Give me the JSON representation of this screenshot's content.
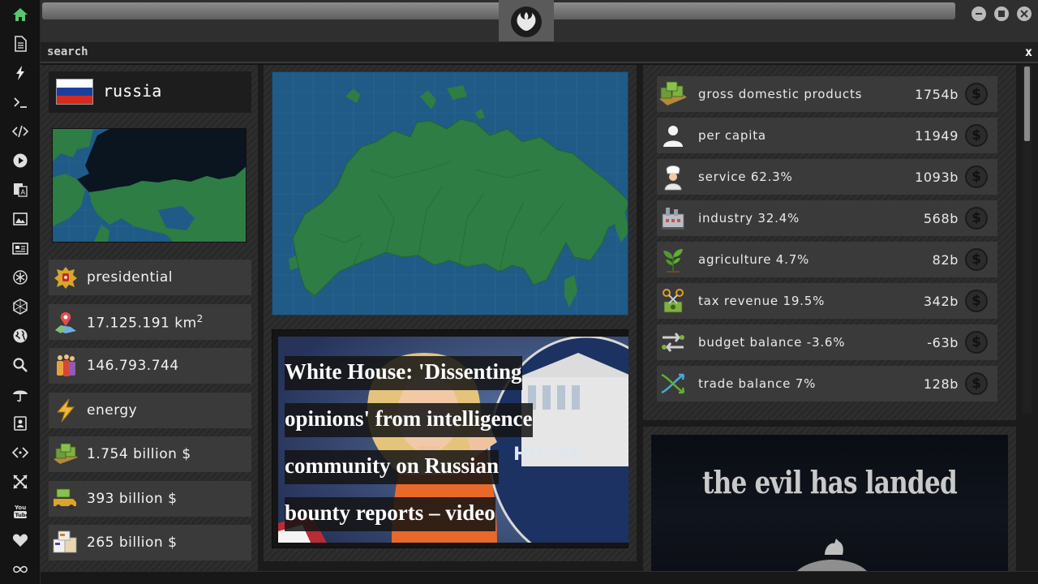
{
  "search": {
    "label": "search",
    "close": "x"
  },
  "country": {
    "name": "russia"
  },
  "stats": [
    {
      "icon": "coat-of-arms-icon",
      "text": "presidential"
    },
    {
      "icon": "map-pin-icon",
      "text": "17.125.191 km",
      "sup": "2"
    },
    {
      "icon": "population-icon",
      "text": "146.793.744"
    },
    {
      "icon": "lightning-icon",
      "text": "energy"
    },
    {
      "icon": "money-stack-icon",
      "text": "1.754 billion $"
    },
    {
      "icon": "export-truck-icon",
      "text": "393 billion $"
    },
    {
      "icon": "import-boxes-icon",
      "text": "265 billion $"
    }
  ],
  "news": {
    "headline_lines": [
      "White House: 'Dissenting",
      "opinions' from intelligence",
      "community on Russian",
      "bounty reports – video"
    ]
  },
  "economy": [
    {
      "icon": "money-stack-icon",
      "label": "gross domestic products",
      "value": "1754b"
    },
    {
      "icon": "person-icon",
      "label": "per capita",
      "value": "11949"
    },
    {
      "icon": "chef-icon",
      "label": "service 62.3%",
      "value": "1093b"
    },
    {
      "icon": "factory-icon",
      "label": "industry 32.4%",
      "value": "568b"
    },
    {
      "icon": "plant-icon",
      "label": "agriculture 4.7%",
      "value": "82b"
    },
    {
      "icon": "tax-scissors-icon",
      "label": "tax revenue 19.5%",
      "value": "342b"
    },
    {
      "icon": "balance-arrows-icon",
      "label": "budget balance -3.6%",
      "value": "-63b"
    },
    {
      "icon": "trade-arrows-icon",
      "label": "trade balance 7%",
      "value": "128b"
    }
  ],
  "coin_symbol": "$",
  "poster": {
    "title": "the evil has landed"
  },
  "colors": {
    "accent_green": "#5cc46a",
    "map_ocean": "#1f5b86",
    "map_land": "#2e7d44",
    "flag_white": "#ffffff",
    "flag_blue": "#1c3f9e",
    "flag_red": "#d52b1e"
  }
}
